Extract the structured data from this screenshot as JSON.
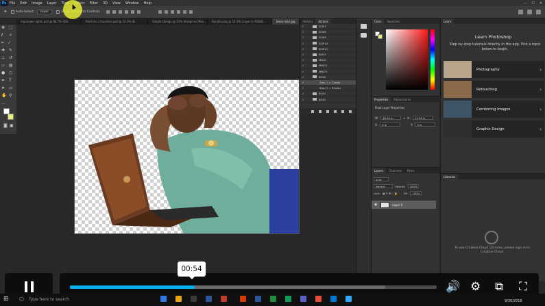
{
  "menu": {
    "items": [
      "File",
      "Edit",
      "Image",
      "Layer",
      "Type",
      "Select",
      "Filter",
      "3D",
      "View",
      "Window",
      "Help"
    ],
    "logo_text": "Ps"
  },
  "options_bar": {
    "auto_select_label": "Auto-Select:",
    "auto_select_value": "Layer",
    "transform_controls_label": "Show Transform Controls"
  },
  "doc_tabs": [
    "mypoojee rights.psd @ 66.7% (GB...",
    "Pardi As a favorites.psd @ 33.3% (B...",
    "Simple Design @ 25% (Image ed Mas...",
    "Bundle.png @ 33.3% (Layer 0, RGB/8...",
    "bene man.jpg"
  ],
  "actions_panel": {
    "tabs": [
      "History",
      "Actions"
    ],
    "rows": [
      {
        "label": "SCM7",
        "type": "folder"
      },
      {
        "label": "SCM8",
        "type": "folder"
      },
      {
        "label": "SCM9",
        "type": "folder"
      },
      {
        "label": "SCM10",
        "type": "folder"
      },
      {
        "label": "SCM11",
        "type": "folder"
      },
      {
        "label": "BUH7",
        "type": "folder"
      },
      {
        "label": "MAG1",
        "type": "folder"
      },
      {
        "label": "MIRO1",
        "type": "folder"
      },
      {
        "label": "MIKU3",
        "type": "folder"
      },
      {
        "label": "BOX2",
        "type": "folder"
      },
      {
        "label": "Step 1 > Create",
        "type": "step"
      },
      {
        "label": "Step 2 > Render",
        "type": "step"
      },
      {
        "label": "BOX1",
        "type": "folder"
      },
      {
        "label": "BOX1",
        "type": "folder"
      }
    ]
  },
  "color_panel": {
    "tabs": [
      "Color",
      "Swatches"
    ],
    "foreground": "#ffffff",
    "background": "#e9ef7c",
    "hue_color": "#ff1a1a"
  },
  "properties_panel": {
    "tabs": [
      "Properties",
      "Adjustments"
    ],
    "title": "Pixel Layer Properties",
    "w_label": "W:",
    "w_value": "16.44 in",
    "h_label": "H:",
    "h_value": "11.24 in",
    "x_label": "X:",
    "x_value": "0 in",
    "y_label": "Y:",
    "y_value": "0 in"
  },
  "layers_panel": {
    "tabs": [
      "Layers",
      "Channels",
      "Paths"
    ],
    "kind_label": "Kind",
    "blend_mode": "Normal",
    "opacity_label": "Opacity:",
    "opacity_value": "100%",
    "lock_label": "Lock:",
    "fill_label": "Fill:",
    "fill_value": "100%",
    "layer_name": "Layer 0"
  },
  "learn_panel": {
    "tab": "Learn",
    "title": "Learn Photoshop",
    "description": "Step-by-step tutorials directly in the app. Pick a topic below to begin.",
    "cards": [
      {
        "label": "Photography",
        "color": "#b8a48a"
      },
      {
        "label": "Retouching",
        "color": "#8a6a4a"
      },
      {
        "label": "Combining Images",
        "color": "#3d5566"
      },
      {
        "label": "Graphic Design",
        "color": "#2e2e2e"
      }
    ],
    "arrow": "›"
  },
  "libraries_panel": {
    "tab": "Libraries",
    "message": "To use Creative Cloud Libraries, please sign in to Creative Cloud."
  },
  "video_player": {
    "time": "00:54",
    "progress": 0.34,
    "buffered": 0.86,
    "accent": "#00adef"
  },
  "taskbar": {
    "search_placeholder": "Type here to search",
    "date": "9/30/2018"
  }
}
